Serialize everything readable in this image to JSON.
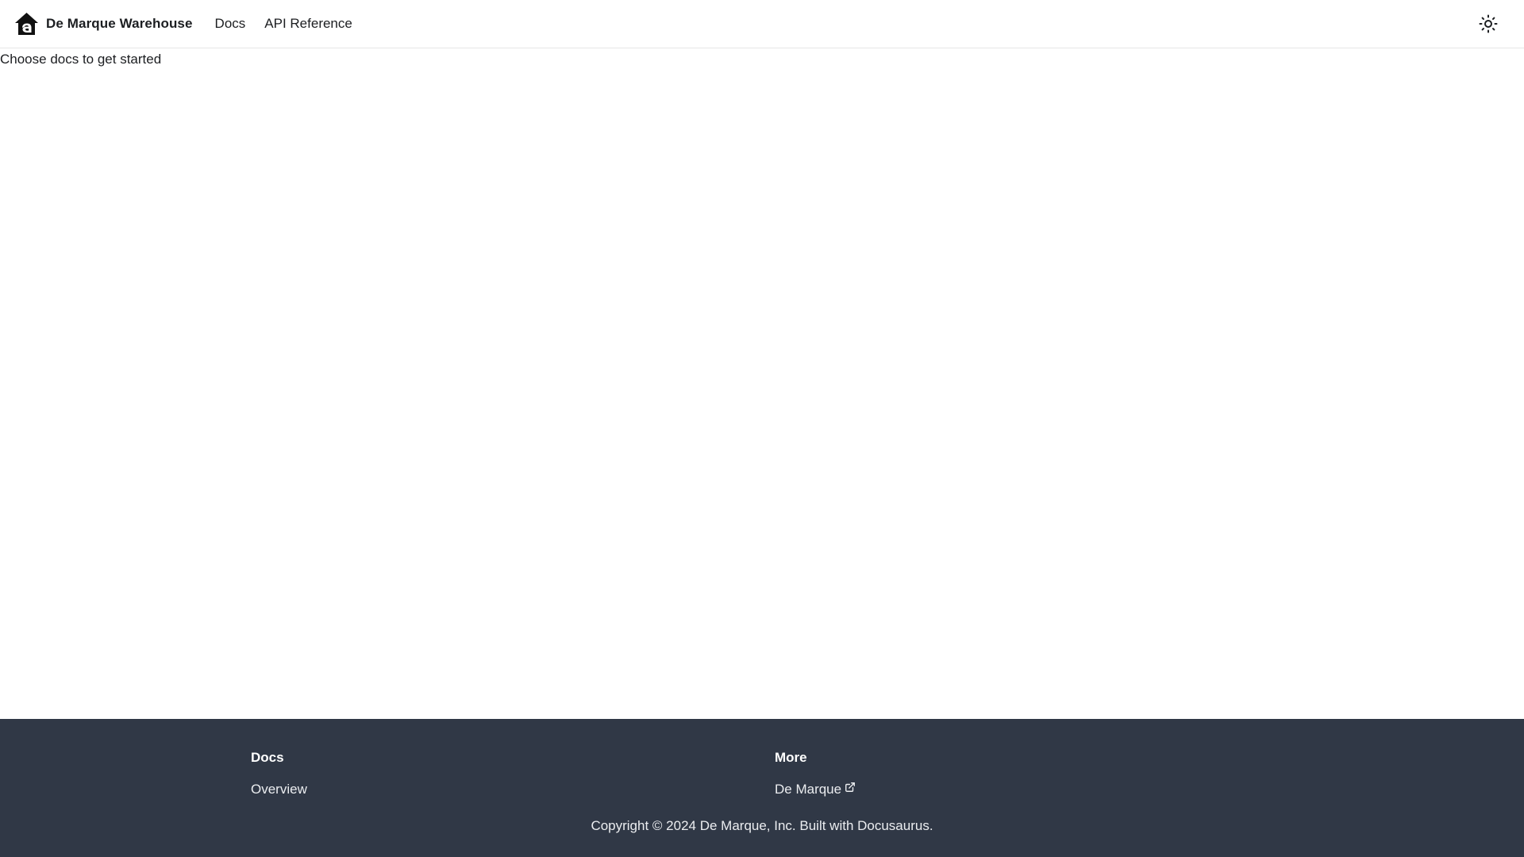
{
  "navbar": {
    "brand_title": "De Marque Warehouse",
    "links": [
      {
        "label": "Docs"
      },
      {
        "label": "API Reference"
      }
    ],
    "theme_toggle_icon": "sun-icon"
  },
  "main": {
    "intro_text": "Choose docs to get started"
  },
  "footer": {
    "columns": [
      {
        "title": "Docs",
        "links": [
          {
            "label": "Overview"
          }
        ]
      },
      {
        "title": "More",
        "links": [
          {
            "label": "De Marque",
            "icon": "external-link-icon"
          }
        ]
      }
    ],
    "copyright": "Copyright © 2024 De Marque, Inc. Built with Docusaurus."
  },
  "colors": {
    "footer_bg": "#303846",
    "text": "#1c1e21",
    "footer_text": "#ebedf0"
  }
}
